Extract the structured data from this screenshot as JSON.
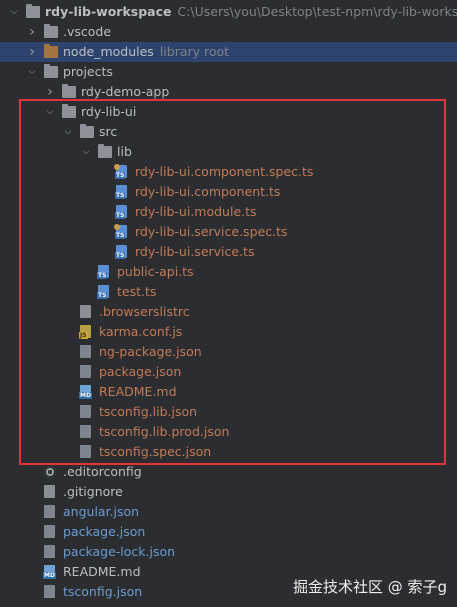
{
  "project": {
    "name": "rdy-lib-workspace",
    "path": "C:\\Users\\you\\Desktop\\test-npm\\rdy-lib-workspace"
  },
  "tree": [
    {
      "label": "rdy-lib-workspace",
      "hint": "C:\\Users\\you\\Desktop\\test-npm\\rdy-lib-workspace",
      "depth": 0,
      "type": "folder",
      "expanded": true,
      "color": "default"
    },
    {
      "label": ".vscode",
      "depth": 1,
      "type": "folder",
      "expanded": false,
      "color": "default"
    },
    {
      "label": "node_modules",
      "hint": "library root",
      "depth": 1,
      "type": "folder-excluded",
      "expanded": false,
      "selected": true,
      "color": "default"
    },
    {
      "label": "projects",
      "depth": 1,
      "type": "folder",
      "expanded": true,
      "color": "default"
    },
    {
      "label": "rdy-demo-app",
      "depth": 2,
      "type": "folder",
      "expanded": false,
      "color": "default"
    },
    {
      "label": "rdy-lib-ui",
      "depth": 2,
      "type": "folder",
      "expanded": true,
      "color": "default"
    },
    {
      "label": "src",
      "depth": 3,
      "type": "folder",
      "expanded": true,
      "color": "default"
    },
    {
      "label": "lib",
      "depth": 4,
      "type": "folder",
      "expanded": true,
      "color": "default"
    },
    {
      "label": "rdy-lib-ui.component.spec.ts",
      "depth": 5,
      "type": "spec",
      "color": "new"
    },
    {
      "label": "rdy-lib-ui.component.ts",
      "depth": 5,
      "type": "ts",
      "color": "new"
    },
    {
      "label": "rdy-lib-ui.module.ts",
      "depth": 5,
      "type": "ts",
      "color": "new"
    },
    {
      "label": "rdy-lib-ui.service.spec.ts",
      "depth": 5,
      "type": "spec",
      "color": "new"
    },
    {
      "label": "rdy-lib-ui.service.ts",
      "depth": 5,
      "type": "ts",
      "color": "new"
    },
    {
      "label": "public-api.ts",
      "depth": 4,
      "type": "ts",
      "color": "new"
    },
    {
      "label": "test.ts",
      "depth": 4,
      "type": "ts",
      "color": "new"
    },
    {
      "label": ".browserslistrc",
      "depth": 3,
      "type": "browsers",
      "color": "new"
    },
    {
      "label": "karma.conf.js",
      "depth": 3,
      "type": "js",
      "color": "new"
    },
    {
      "label": "ng-package.json",
      "depth": 3,
      "type": "json",
      "color": "new"
    },
    {
      "label": "package.json",
      "depth": 3,
      "type": "json",
      "color": "new"
    },
    {
      "label": "README.md",
      "depth": 3,
      "type": "md",
      "color": "new"
    },
    {
      "label": "tsconfig.lib.json",
      "depth": 3,
      "type": "json",
      "color": "new"
    },
    {
      "label": "tsconfig.lib.prod.json",
      "depth": 3,
      "type": "json",
      "color": "new"
    },
    {
      "label": "tsconfig.spec.json",
      "depth": 3,
      "type": "json",
      "color": "new"
    },
    {
      "label": ".editorconfig",
      "depth": 1,
      "type": "gear",
      "color": "default"
    },
    {
      "label": ".gitignore",
      "depth": 1,
      "type": "git",
      "color": "default"
    },
    {
      "label": "angular.json",
      "depth": 1,
      "type": "json",
      "color": "mod"
    },
    {
      "label": "package.json",
      "depth": 1,
      "type": "json",
      "color": "mod"
    },
    {
      "label": "package-lock.json",
      "depth": 1,
      "type": "json",
      "color": "mod"
    },
    {
      "label": "README.md",
      "depth": 1,
      "type": "md",
      "color": "default"
    },
    {
      "label": "tsconfig.json",
      "depth": 1,
      "type": "json",
      "color": "mod"
    }
  ],
  "icon_tags": {
    "ts": "TS",
    "spec": "TS",
    "js": "JS",
    "md": "MD"
  },
  "colors": {
    "background": "#2b2d30",
    "selected_row": "#2e436e",
    "text_default": "#bbbec4",
    "text_modified": "#6b9bd2",
    "text_new": "#c27a57",
    "highlight_border": "#e0343a"
  },
  "watermark": "掘金技术社区 @ 索子g"
}
